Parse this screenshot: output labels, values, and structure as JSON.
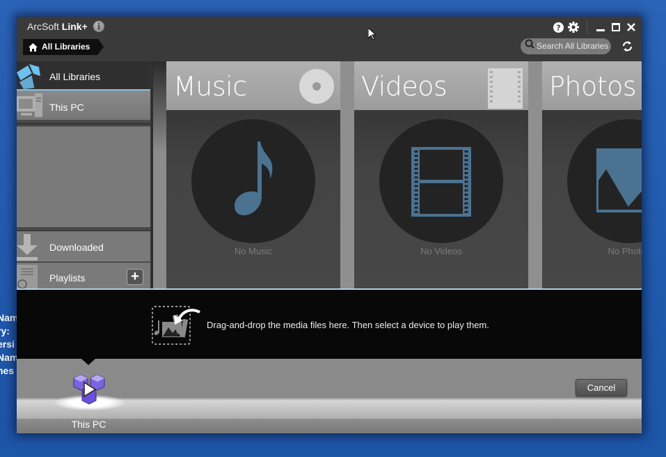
{
  "desktop": {
    "background_text": [
      "Nam",
      "ry:",
      "ersi",
      "Nam",
      "nes"
    ]
  },
  "window": {
    "app_name": "ArcSoft",
    "app_name_bold": "Link+",
    "info_icon": "info-icon",
    "title_icons": [
      "help-icon",
      "gear-icon",
      "minimize-icon",
      "maximize-icon",
      "close-icon"
    ]
  },
  "breadcrumb": {
    "icon": "home-icon",
    "label": "All Libraries"
  },
  "search": {
    "placeholder": "Search All Libraries",
    "icon": "search-icon"
  },
  "refresh_icon": "refresh-icon",
  "sidebar": {
    "items": [
      {
        "label": "All Libraries",
        "icon": "box-icon",
        "selected": true
      },
      {
        "label": "This PC",
        "icon": "computer-icon"
      },
      {
        "label": "Downloaded",
        "icon": "download-icon"
      },
      {
        "label": "Playlists",
        "icon": "playlist-icon",
        "action": "+"
      }
    ]
  },
  "tiles": [
    {
      "title": "Music",
      "empty_text": "No Music",
      "icon": "music-note-icon",
      "head_icon": "disc-icon"
    },
    {
      "title": "Videos",
      "empty_text": "No Videos",
      "icon": "film-icon",
      "head_icon": "filmstrip-icon"
    },
    {
      "title": "Photos",
      "empty_text": "No Photos",
      "icon": "photo-icon"
    }
  ],
  "dropzone": {
    "text": "Drag-and-drop the media files here. Then select a device to play them.",
    "icon": "drop-media-icon"
  },
  "devices": [
    {
      "label": "This PC",
      "icon": "pc-player-icon"
    }
  ],
  "cancel_label": "Cancel",
  "colors": {
    "accent": "#7fc1e8",
    "icon_blue": "#4b7391",
    "tile_header": "#a8a8a8",
    "desktop": "#2a63b8"
  }
}
